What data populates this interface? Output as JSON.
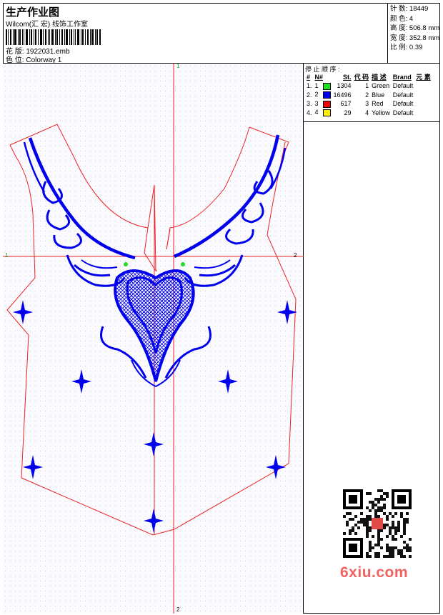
{
  "header": {
    "title": "生产作业图",
    "subtitle": "Wilcom(汇 宏) 线饰工作室",
    "design_label": "花 版:",
    "design_value": "1922031.emb",
    "colorway_label": "色 位:",
    "colorway_value": "Colorway 1"
  },
  "stats": {
    "stitches_label": "针 数:",
    "stitches_value": "18449",
    "colors_label": "颜 色:",
    "colors_value": "4",
    "height_label": "高 度:",
    "height_value": "506.8 mm",
    "width_label": "宽 度:",
    "width_value": "352.8 mm",
    "scale_label": "比 例:",
    "scale_value": "0.39"
  },
  "sequence": {
    "title": "停 止 顺 序 :",
    "headers": [
      "#",
      "N#",
      "St.",
      "代 码",
      "描 述",
      "Brand",
      "元 素"
    ],
    "rows": [
      {
        "n": "1.",
        "code_no": "1",
        "color": "#22dd22",
        "st": "1304",
        "code": "1",
        "desc": "Green",
        "brand": "Default"
      },
      {
        "n": "2.",
        "code_no": "2",
        "color": "#0000ee",
        "st": "16496",
        "code": "2",
        "desc": "Blue",
        "brand": "Default"
      },
      {
        "n": "3.",
        "code_no": "3",
        "color": "#ee0000",
        "st": "617",
        "code": "3",
        "desc": "Red",
        "brand": "Default"
      },
      {
        "n": "4.",
        "code_no": "4",
        "color": "#ffee00",
        "st": "29",
        "code": "4",
        "desc": "Yellow",
        "brand": "Default"
      }
    ]
  },
  "canvas": {
    "axis_top": "1",
    "axis_bottom": "2",
    "axis_left": "1",
    "axis_right": "2",
    "colors": {
      "outline": "#ee2222",
      "embroidery": "#0000ee",
      "accent": "#22dd22"
    }
  },
  "qr": {
    "icon": "qr-code-icon"
  },
  "watermark": {
    "text": "6xiu.com"
  }
}
